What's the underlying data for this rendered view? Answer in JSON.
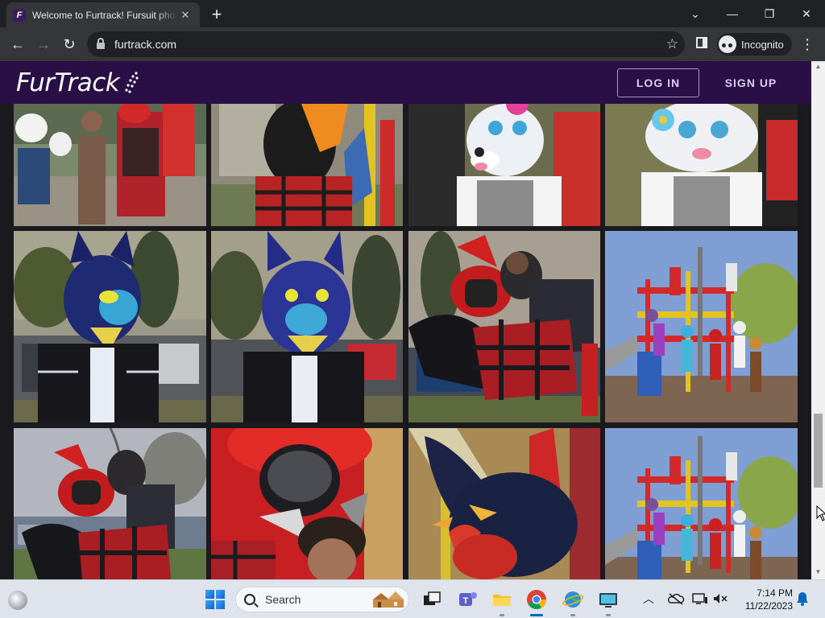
{
  "browser": {
    "tab_title": "Welcome to Furtrack! Fursuit photos",
    "favicon_text": "F",
    "tab_close": "✕",
    "new_tab": "+",
    "url": "furtrack.com",
    "incognito_label": "Incognito",
    "window_controls": {
      "minimize": "—",
      "restore": "❐",
      "close": "✕",
      "tab_search": "⌄"
    }
  },
  "site": {
    "logo": "FurTrack",
    "nav": {
      "login": "LOG IN",
      "signup": "SIGN UP"
    },
    "brand_color": "#2a0f46"
  },
  "gallery": {
    "rows": [
      [
        "Group photo with fursuiters",
        "Fursuiter in red plaid by playground",
        "White fursuit with blue eyes",
        "White fursuit with pink flower"
      ],
      [
        "Blue wolf fursuit side view",
        "Blue wolf fursuit front view",
        "Red fursuiter carrying person",
        "Group photo on playground"
      ],
      [
        "Red fursuiter carrying person",
        "Red fursuit close-up with person",
        "Black dragon fursuit close-up",
        "Group photo on playground"
      ]
    ]
  },
  "taskbar": {
    "search_placeholder": "Search",
    "time": "7:14 PM",
    "date": "11/22/2023"
  }
}
